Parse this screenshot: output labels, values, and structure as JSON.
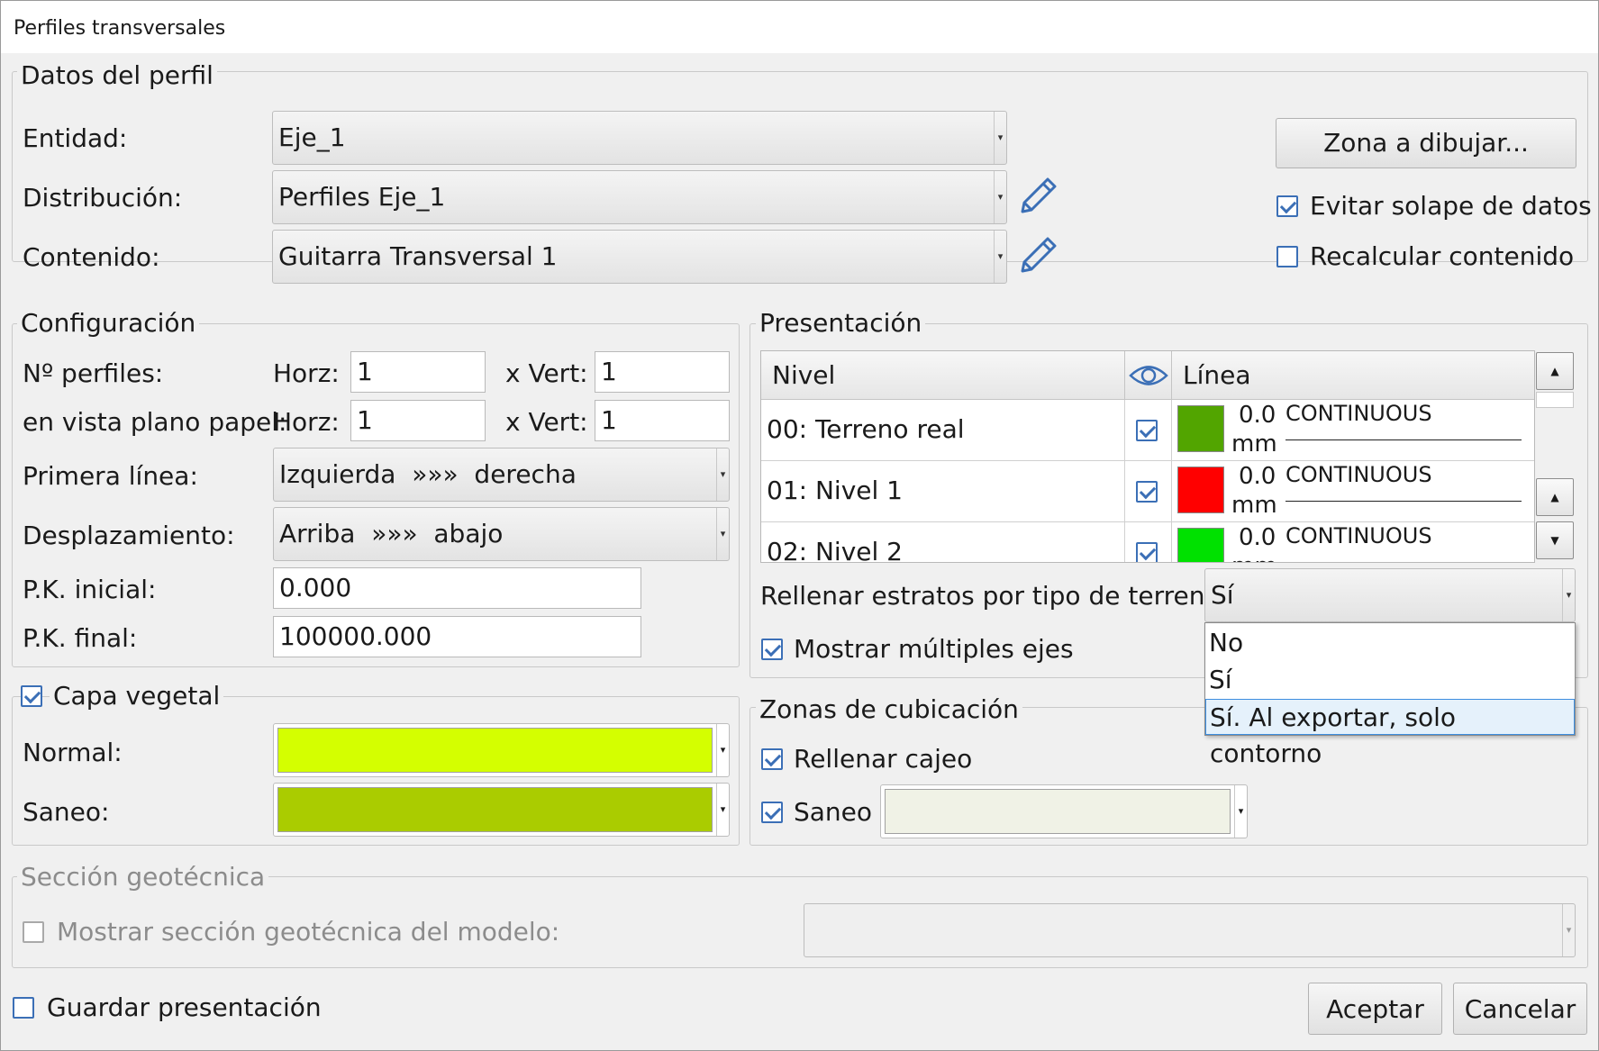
{
  "window": {
    "title": "Perfiles transversales"
  },
  "datos": {
    "legend": "Datos del perfil",
    "entidad_label": "Entidad:",
    "entidad_value": "Eje_1",
    "distribucion_label": "Distribución:",
    "distribucion_value": "Perfiles Eje_1",
    "contenido_label": "Contenido:",
    "contenido_value": "Guitarra Transversal 1",
    "zona_button": "Zona a dibujar...",
    "evitar_label": "Evitar solape de datos",
    "recalcular_label": "Recalcular contenido"
  },
  "config": {
    "legend": "Configuración",
    "nperfiles_label": "Nº perfiles:",
    "vista_label": "en vista plano papel:",
    "horz_label": "Horz:",
    "vert_label": "x Vert:",
    "nperfiles_horz": "1",
    "nperfiles_vert": "1",
    "vista_horz": "1",
    "vista_vert": "1",
    "primera_label": "Primera línea:",
    "primera_value": "Izquierda  »»»  derecha",
    "desplaz_label": "Desplazamiento:",
    "desplaz_value": "Arriba  »»»  abajo",
    "pk_inicial_label": "P.K. inicial:",
    "pk_inicial_value": "0.000",
    "pk_final_label": "P.K. final:",
    "pk_final_value": "100000.000"
  },
  "presentacion": {
    "legend": "Presentación",
    "col_nivel": "Nivel",
    "col_linea": "Línea",
    "rows": [
      {
        "name": "00: Terreno real",
        "color": "#52a500",
        "width": "0.0",
        "unit": "mm",
        "linetype": "CONTINUOUS"
      },
      {
        "name": "01: Nivel 1",
        "color": "#ff0000",
        "width": "0.0",
        "unit": "mm",
        "linetype": "CONTINUOUS"
      },
      {
        "name": "02: Nivel 2",
        "color": "#00e100",
        "width": "0.0",
        "unit": "mm",
        "linetype": "CONTINUOUS"
      }
    ],
    "rellenar_label": "Rellenar estratos por tipo de terreno:",
    "rellenar_value": "Sí",
    "rellenar_options": [
      "No",
      "Sí",
      "Sí. Al exportar, solo contorno"
    ],
    "mostrar_ejes_label": "Mostrar múltiples ejes"
  },
  "capa": {
    "legend": "Capa vegetal",
    "normal_label": "Normal:",
    "normal_color": "#d4ff00",
    "saneo_label": "Saneo:",
    "saneo_color": "#aacc00"
  },
  "zonas": {
    "legend": "Zonas de cubicación",
    "rellenar_cajeo_label": "Rellenar cajeo",
    "saneo_label": "Saneo",
    "saneo_color": "#f0f2e6"
  },
  "geotecnica": {
    "legend": "Sección geotécnica",
    "mostrar_label": "Mostrar sección geotécnica del modelo:"
  },
  "footer": {
    "guardar_label": "Guardar presentación",
    "aceptar": "Aceptar",
    "cancelar": "Cancelar"
  }
}
